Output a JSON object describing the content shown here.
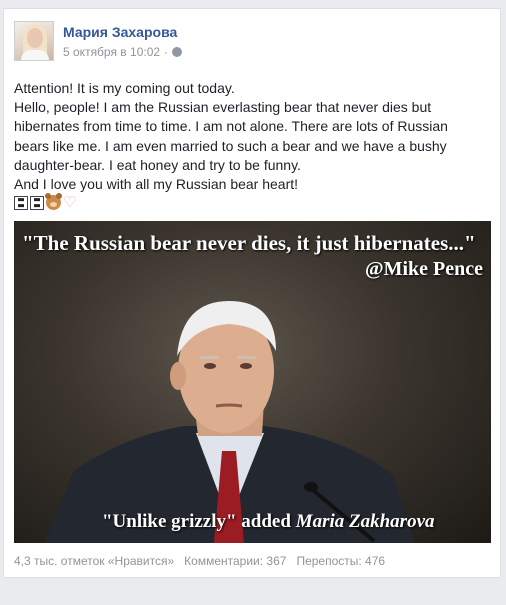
{
  "post": {
    "author": "Мария Захарова",
    "timestamp": "5 октября в 10:02",
    "separator": "·",
    "privacy_icon": "globe-icon",
    "text_lines": [
      "Attention! It is my coming out today.",
      "Hello, people! I am the Russian everlasting bear that never dies but hibernates from time to time. I am not alone. There are lots of Russian bears like me. I am even married to such a bear and we have a bushy daughter-bear. I eat honey and try to be funny.",
      "And I love you with all my Russian bear heart!"
    ],
    "emoji": [
      "flag-icon",
      "flag-icon",
      "bear-face-icon",
      "heart-icon"
    ]
  },
  "image": {
    "quote_top": "\"The Russian bear never dies, it just hibernates...\"",
    "quote_author": "@Mike Pence",
    "quote_bottom_prefix": "\"Unlike grizzly\" added ",
    "quote_bottom_name": "Maria Zakharova"
  },
  "stats": {
    "likes": "4,3 тыс. отметок «Нравится»",
    "comments": "Комментарии: 367",
    "shares": "Перепосты: 476"
  },
  "colors": {
    "author_link": "#365899",
    "meta_gray": "#90949c",
    "background": "#e9ebee"
  }
}
